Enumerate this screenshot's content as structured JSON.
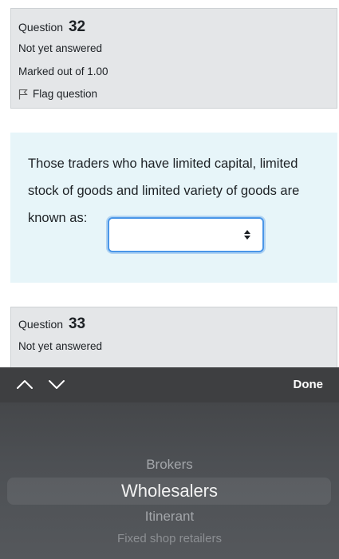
{
  "q32": {
    "label": "Question",
    "number": "32",
    "state": "Not yet answered",
    "grade": "Marked out of 1.00",
    "flag_label": "Flag question"
  },
  "formulation": {
    "line1": "Those traders who have limited capital, limited",
    "line2": "stock of goods and limited variety of goods are",
    "line3": "known as:",
    "select_value": ""
  },
  "q33": {
    "label": "Question",
    "number": "33",
    "state": "Not yet answered"
  },
  "picker": {
    "done_label": "Done",
    "options": [
      "Brokers",
      "Wholesalers",
      "Itinerant",
      "Fixed shop retailers"
    ],
    "selected": "Wholesalers"
  },
  "icons": {
    "flag": "flag-icon",
    "prev": "chevron-up-icon",
    "next": "chevron-down-icon",
    "select": "select-arrows-icon"
  },
  "colors": {
    "info_bg": "#e4e6e8",
    "formulation_bg": "#e7f5f9",
    "focus_border": "#4a96e8",
    "picker_bg": "#4d5054"
  }
}
